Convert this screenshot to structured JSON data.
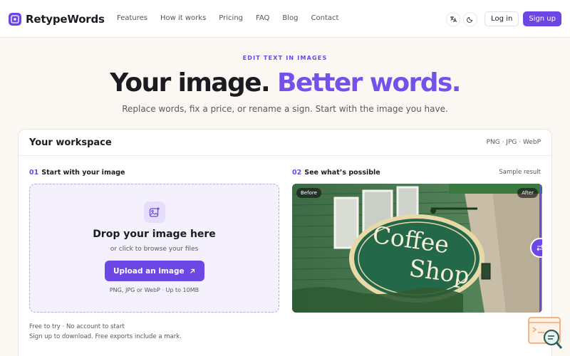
{
  "brand": {
    "name": "RetypeWords",
    "accent": "#6c47e6"
  },
  "nav": [
    {
      "label": "Features"
    },
    {
      "label": "How it works"
    },
    {
      "label": "Pricing"
    },
    {
      "label": "FAQ"
    },
    {
      "label": "Blog"
    },
    {
      "label": "Contact"
    }
  ],
  "header_actions": {
    "translate_icon": "translate-icon",
    "theme_icon": "moon-icon",
    "login_label": "Log in",
    "signup_label": "Sign up"
  },
  "hero": {
    "eyebrow": "EDIT TEXT IN IMAGES",
    "title_main": "Your image.",
    "title_accent": "Better words.",
    "subtitle": "Replace words, fix a price, or rename a sign. Start with the image you have."
  },
  "workspace": {
    "title": "Your workspace",
    "formats": "PNG · JPG · WebP",
    "step1": {
      "num": "01",
      "label": "Start with your image"
    },
    "step2": {
      "num": "02",
      "label": "See what’s possible"
    },
    "sample_label": "Sample result",
    "dropzone": {
      "title": "Drop your image here",
      "subtitle": "or click to browse your files",
      "button_label": "Upload an image",
      "note": "PNG, JPG or WebP · Up to 10MB"
    },
    "footnote_1": "Free to try · No account to start",
    "footnote_2": "Sign up to download. Free exports include a mark.",
    "preview": {
      "before_tag": "Before",
      "after_tag": "After",
      "sign_line1": "Coffee",
      "sign_line2": "Shop"
    }
  }
}
